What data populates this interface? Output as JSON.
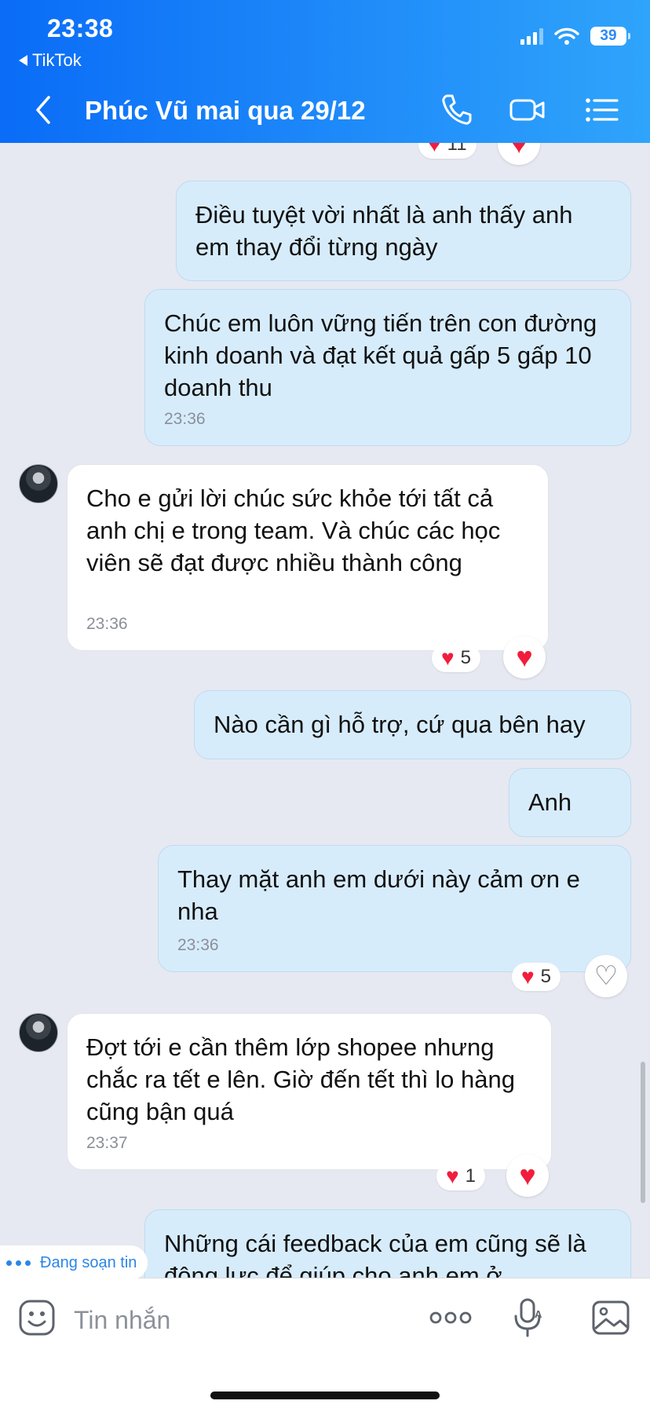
{
  "status": {
    "time": "23:38",
    "back_app": "TikTok",
    "battery": "39"
  },
  "header": {
    "title": "Phúc Vũ mai qua 29/12"
  },
  "messages": [
    {
      "text": "Điều tuyệt vời nhất là anh thấy anh em thay đổi từng ngày",
      "time": ""
    },
    {
      "text": "Chúc em luôn vững tiến trên con đường kinh doanh và đạt kết quả gấp 5 gấp 10 doanh thu",
      "time": "23:36"
    },
    {
      "text": "Cho e gửi lời chúc sức khỏe tới tất cả anh chị e trong team. Và chúc các học viên sẽ đạt được nhiều thành công",
      "time": "23:36",
      "reactions": "5"
    },
    {
      "text": "Nào cần gì hỗ trợ, cứ qua bên hay",
      "time": ""
    },
    {
      "text": "Anh",
      "time": ""
    },
    {
      "text": "Thay mặt anh em dưới này cảm ơn e nha",
      "time": "23:36",
      "reactions": "5"
    },
    {
      "text": "Đợt tới e cần thêm lớp shopee nhưng chắc ra tết e lên. Giờ đến tết thì lo hàng cũng bận quá",
      "time": "23:37",
      "reactions": "1"
    },
    {
      "text": "Những cái feedback của em cũng sẽ là động lực để giúp cho anh em ở",
      "time": ""
    }
  ],
  "top_reaction_count": "11",
  "typing": {
    "label": "Đang soạn tin"
  },
  "input": {
    "placeholder": "Tin nhắn"
  },
  "colors": {
    "header_start": "#0a6cf7",
    "header_end": "#2fa4fb",
    "outgoing_bubble": "#d7ecfb",
    "incoming_bubble": "#ffffff",
    "heart": "#f01e3c",
    "chat_bg": "#e6e9f1"
  }
}
